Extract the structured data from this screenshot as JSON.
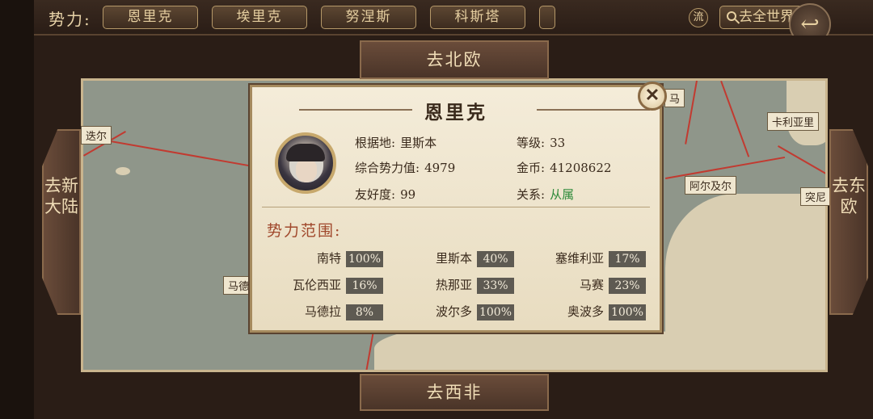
{
  "topbar": {
    "faction_label": "势力:",
    "tabs": [
      "恩里克",
      "埃里克",
      "努涅斯",
      "科斯塔"
    ],
    "flow_label": "流",
    "world_label": "去全世界",
    "back_icon": "back-arrow-icon"
  },
  "nav": {
    "north": "去北欧",
    "south": "去西非",
    "west": "去新大陆",
    "east": "去东欧"
  },
  "map_labels": {
    "ducr": "迭尔",
    "calliari": "卡利亚里",
    "algeria": "阿尔及尔",
    "ma": "马",
    "madeira_partial": "马德",
    "tunis_partial": "突尼"
  },
  "dialog": {
    "title": "恩里克",
    "close_icon": "close-icon",
    "base_label": "根据地:",
    "base_value": "里斯本",
    "level_label": "等级:",
    "level_value": "33",
    "power_label": "综合势力值:",
    "power_value": "4979",
    "gold_label": "金币:",
    "gold_value": "41208622",
    "friend_label": "友好度:",
    "friend_value": "99",
    "relation_label": "关系:",
    "relation_value": "从属",
    "range_title": "势力范围:",
    "cities": [
      {
        "name": "南特",
        "pct": "100%"
      },
      {
        "name": "里斯本",
        "pct": "40%"
      },
      {
        "name": "塞维利亚",
        "pct": "17%"
      },
      {
        "name": "瓦伦西亚",
        "pct": "16%"
      },
      {
        "name": "热那亚",
        "pct": "33%"
      },
      {
        "name": "马赛",
        "pct": "23%"
      },
      {
        "name": "马德拉",
        "pct": "8%"
      },
      {
        "name": "波尔多",
        "pct": "100%"
      },
      {
        "name": "奥波多",
        "pct": "100%"
      }
    ]
  }
}
